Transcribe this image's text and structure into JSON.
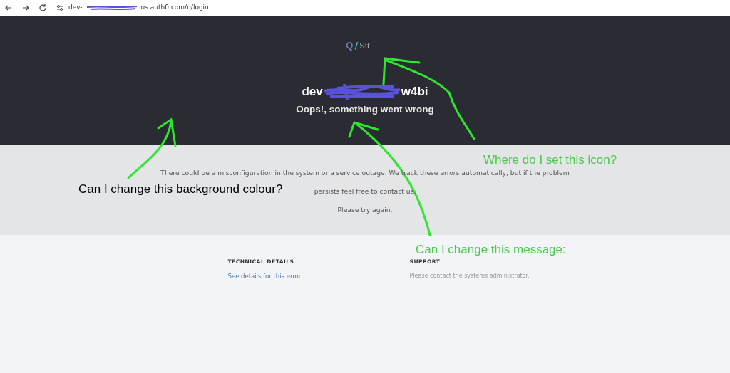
{
  "browser": {
    "url_start": "dev-",
    "url_end": "us.auth0.com/u/login"
  },
  "header": {
    "logo_mark": "Q",
    "logo_separator": "/",
    "logo_text": "Sit",
    "title_start": "dev",
    "title_end": "w4bi",
    "subtitle": "Oops!, something went wrong"
  },
  "message": {
    "lines": [
      "There could be a misconfiguration in the system or a service outage. We track these errors automatically, but if the problem",
      "persists feel free to contact us.",
      "Please try again."
    ]
  },
  "footer": {
    "columns": [
      {
        "kind": "link",
        "heading": "TECHNICAL DETAILS",
        "text": "See details for this error"
      },
      {
        "kind": "note",
        "heading": "SUPPORT",
        "text": "Please contact the systems administrator."
      }
    ]
  },
  "annotations": [
    {
      "text": "Where do I set this icon?",
      "color": "#4cc94c"
    },
    {
      "text": "Can I change this background colour?",
      "color": "#000000"
    },
    {
      "text": "Can I change this message:",
      "color": "#4cc94c"
    }
  ]
}
